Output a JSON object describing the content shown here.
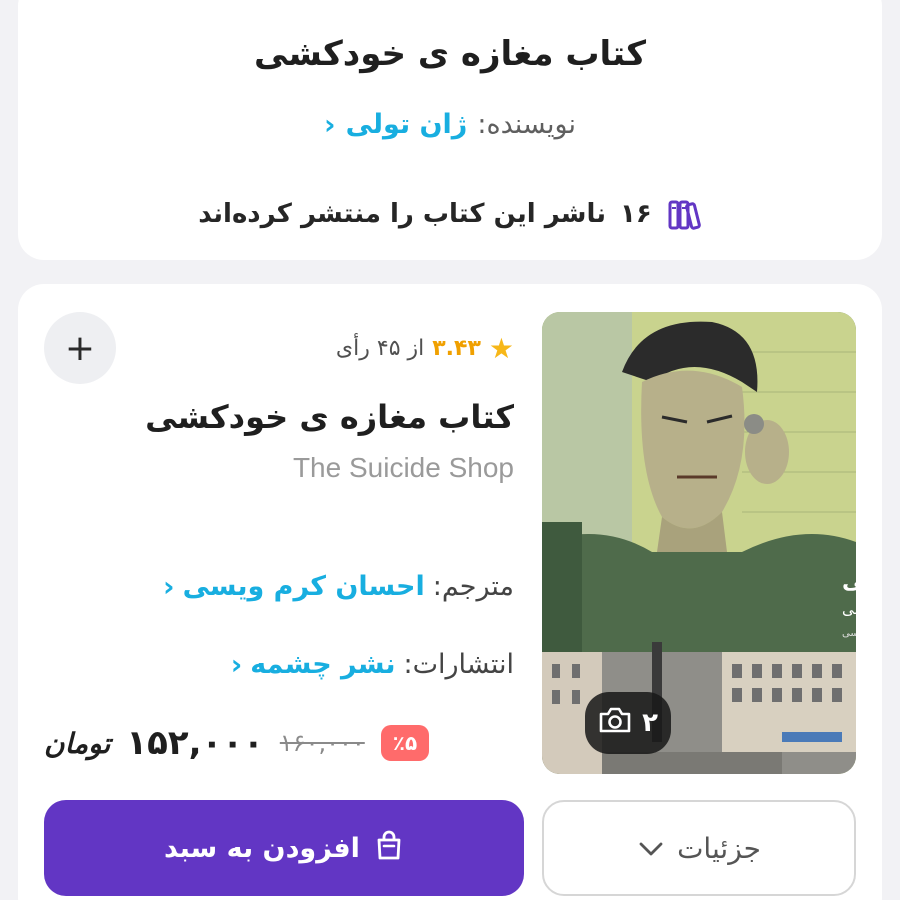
{
  "summary": {
    "title": "کتاب مغازه ی خودکشی",
    "author_label": "نویسنده:",
    "author_name": "ژان تولی",
    "publishers_count": "۱۶",
    "publishers_text": "ناشر این کتاب را منتشر کرده‌اند"
  },
  "product": {
    "rating_value": "۳.۴۳",
    "rating_of": "از ۴۵ رأی",
    "title": "کتاب مغازه ی خودکشی",
    "title_en": "The Suicide Shop",
    "translator_label": "مترجم:",
    "translator_name": "احسان کرم ویسی",
    "publisher_label": "انتشارات:",
    "publisher_name": "نشر چشمه",
    "image_count": "۲",
    "cover_title": "مغازه‌ی خودکشی",
    "cover_author": "ژان تولی",
    "cover_translator": "ترجمه‌ی احسان کرم‌ویسی",
    "discount": "٪۵",
    "old_price": "۱۶۰,۰۰۰",
    "new_price": "۱۵۲,۰۰۰",
    "currency": "تومان",
    "add_to_cart": "افزودن به سبد",
    "details": "جزئیات"
  },
  "colors": {
    "accent": "#6236c4",
    "link": "#18aee0",
    "discount": "#ff6b6b",
    "star": "#f7b718"
  },
  "icons": {
    "books": "books-icon",
    "star": "star-icon",
    "camera": "camera-icon",
    "cart": "shopping-bag-icon",
    "details": "chevron-down-icon",
    "add": "plus-icon"
  }
}
